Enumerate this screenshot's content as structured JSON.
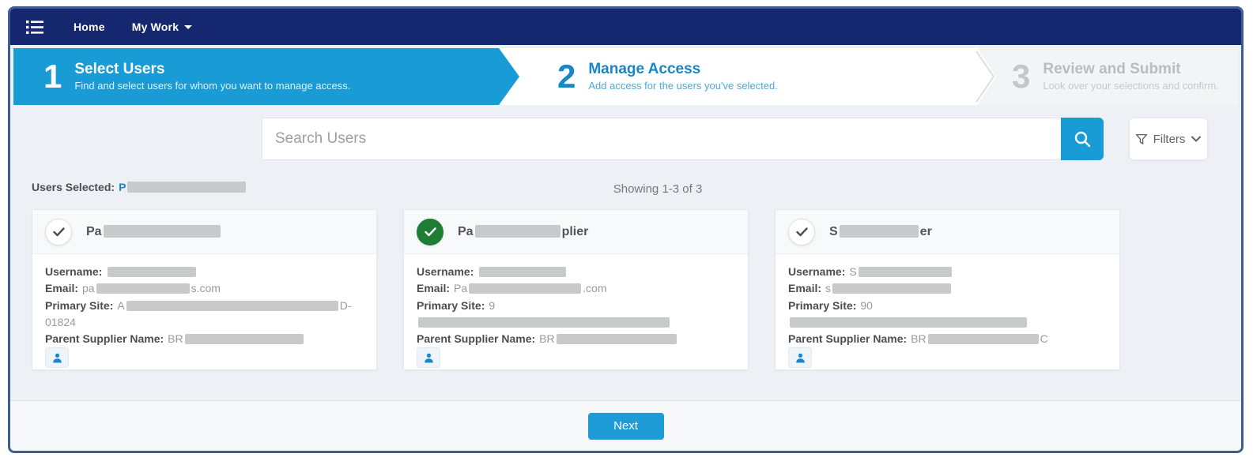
{
  "navbar": {
    "home_label": "Home",
    "my_work_label": "My Work"
  },
  "stepper": {
    "steps": [
      {
        "number": "1",
        "title": "Select Users",
        "subtitle": "Find and select users for whom you want to manage access.",
        "state": "active"
      },
      {
        "number": "2",
        "title": "Manage Access",
        "subtitle": "Add access for the users you've selected.",
        "state": "next"
      },
      {
        "number": "3",
        "title": "Review and Submit",
        "subtitle": "Look over your selections and confirm.",
        "state": "upcoming"
      }
    ]
  },
  "search": {
    "placeholder": "Search Users",
    "filters_label": "Filters"
  },
  "status": {
    "users_selected_label": "Users Selected:",
    "users_selected_visible_value": "P",
    "users_selected_redaction": "width:150px",
    "showing_text": "Showing 1-3 of 3"
  },
  "cards": [
    {
      "selected": false,
      "check_class": "check-circle",
      "title": {
        "prefix": "Pa",
        "redaction": "width:148px",
        "suffix": ""
      },
      "fields": [
        {
          "label": "Username:",
          "prefix": "",
          "redaction": "width:112px",
          "suffix": ""
        },
        {
          "label": "Email:",
          "prefix": "pa",
          "redaction": "width:118px",
          "suffix": "s.com"
        },
        {
          "label": "Primary Site:",
          "prefix": "A",
          "redaction": "width:268px",
          "suffix": "D-01824"
        },
        {
          "label": "Parent Supplier Name:",
          "prefix": "BR",
          "redaction": "width:150px",
          "suffix": ""
        }
      ]
    },
    {
      "selected": true,
      "check_class": "check-circle selected",
      "title": {
        "prefix": "Pa",
        "redaction": "width:108px",
        "suffix": "plier"
      },
      "fields": [
        {
          "label": "Username:",
          "prefix": "",
          "redaction": "width:110px",
          "suffix": ""
        },
        {
          "label": "Email:",
          "prefix": "Pa",
          "redaction": "width:142px",
          "suffix": ".com"
        },
        {
          "label": "Primary Site:",
          "prefix": "9",
          "redaction": "width:318px",
          "suffix": ""
        },
        {
          "label": "Parent Supplier Name:",
          "prefix": "BR",
          "redaction": "width:152px",
          "suffix": ""
        }
      ]
    },
    {
      "selected": false,
      "check_class": "check-circle",
      "title": {
        "prefix": "S",
        "redaction": "width:100px",
        "suffix": "er"
      },
      "fields": [
        {
          "label": "Username:",
          "prefix": "S",
          "redaction": "width:118px",
          "suffix": ""
        },
        {
          "label": "Email:",
          "prefix": "s",
          "redaction": "width:150px",
          "suffix": ""
        },
        {
          "label": "Primary Site:",
          "prefix": "90",
          "redaction": "width:300px",
          "suffix": ""
        },
        {
          "label": "Parent Supplier Name:",
          "prefix": "BR",
          "redaction": "width:140px",
          "suffix": "C"
        }
      ]
    }
  ],
  "footer": {
    "next_label": "Next"
  },
  "colors": {
    "navbar_navy": "#14276F",
    "accent_blue": "#199BD5",
    "step_text_blue": "#1787C8",
    "selected_green": "#1E7D34",
    "frame_border": "#3D5E93",
    "redaction_gray": "#C7C9CB"
  }
}
